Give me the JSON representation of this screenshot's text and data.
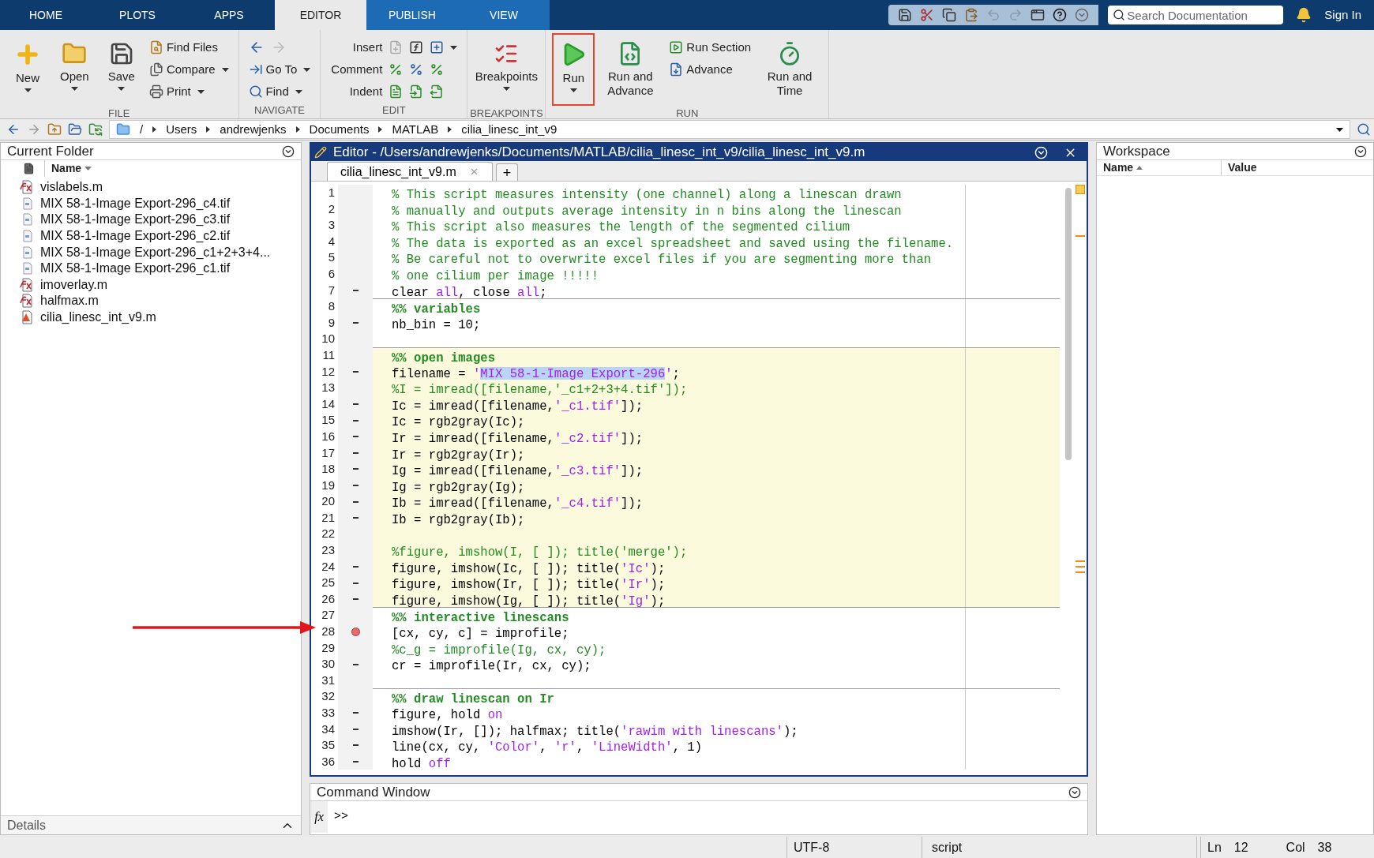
{
  "top_tabs": [
    {
      "label": "HOME",
      "selected": false,
      "contextual": false
    },
    {
      "label": "PLOTS",
      "selected": false,
      "contextual": false
    },
    {
      "label": "APPS",
      "selected": false,
      "contextual": false
    },
    {
      "label": "EDITOR",
      "selected": true
    },
    {
      "label": "PUBLISH",
      "selected": false,
      "contextual": true
    },
    {
      "label": "VIEW",
      "selected": false,
      "contextual": true
    }
  ],
  "search": {
    "placeholder": "Search Documentation"
  },
  "sign_in": "Sign In",
  "ribbon": [
    {
      "label": "FILE",
      "buttons": [
        {
          "kind": "large",
          "label": "New",
          "dropdown": true,
          "outlined": false
        },
        {
          "kind": "large",
          "label": "Open",
          "dropdown": true,
          "outlined": false
        },
        {
          "kind": "large",
          "label": "Save",
          "dropdown": true,
          "outlined": false
        },
        {
          "kind": "small",
          "label": "Find Files",
          "dropdown": false
        },
        {
          "kind": "small",
          "label": "Compare",
          "dropdown": true
        },
        {
          "kind": "small",
          "label": "Print",
          "dropdown": true
        }
      ]
    },
    {
      "label": "NAVIGATE",
      "buttons": [
        {
          "kind": "arrows"
        },
        {
          "kind": "small",
          "label": "Go To",
          "dropdown": true
        },
        {
          "kind": "small",
          "label": "Find",
          "dropdown": true
        }
      ]
    },
    {
      "label": "EDIT",
      "buttons": [
        {
          "kind": "edit_row",
          "label": "Insert"
        },
        {
          "kind": "edit_row",
          "label": "Comment"
        },
        {
          "kind": "edit_row",
          "label": "Indent"
        }
      ]
    },
    {
      "label": "BREAKPOINTS",
      "buttons": [
        {
          "kind": "large",
          "label": "Breakpoints",
          "dropdown": true,
          "outlined": false
        }
      ]
    },
    {
      "label": "RUN",
      "buttons": [
        {
          "kind": "large",
          "label": "Run",
          "dropdown": true,
          "outlined": true
        },
        {
          "kind": "large",
          "label": "Run and Advance",
          "dropdown": false,
          "outlined": false
        },
        {
          "kind": "small",
          "label": "Run Section",
          "dropdown": false
        },
        {
          "kind": "small",
          "label": "Advance",
          "dropdown": false
        },
        {
          "kind": "large",
          "label": "Run and Time",
          "dropdown": false,
          "outlined": false
        }
      ]
    }
  ],
  "path": [
    "/",
    "Users",
    "andrewjenks",
    "Documents",
    "MATLAB",
    "cilia_linesc_int_v9"
  ],
  "current_folder": {
    "title": "Current Folder",
    "column": "Name",
    "files": [
      {
        "kind": "function",
        "name": "vislabels.m"
      },
      {
        "kind": "image",
        "name": "MIX 58-1-Image Export-296_c4.tif"
      },
      {
        "kind": "image",
        "name": "MIX 58-1-Image Export-296_c3.tif"
      },
      {
        "kind": "image",
        "name": "MIX 58-1-Image Export-296_c2.tif"
      },
      {
        "kind": "image",
        "name": "MIX 58-1-Image Export-296_c1+2+3+4..."
      },
      {
        "kind": "image",
        "name": "MIX 58-1-Image Export-296_c1.tif"
      },
      {
        "kind": "function",
        "name": "imoverlay.m"
      },
      {
        "kind": "function",
        "name": "halfmax.m"
      },
      {
        "kind": "script",
        "name": "cilia_linesc_int_v9.m"
      }
    ],
    "details": "Details"
  },
  "editor": {
    "title": "Editor - /Users/andrewjenks/Documents/MATLAB/cilia_linesc_int_v9/cilia_linesc_int_v9.m",
    "tabs": [
      {
        "label": "cilia_linesc_int_v9.m",
        "selected": true
      }
    ],
    "add_tab": "+",
    "lines": [
      {
        "n": "1",
        "exec": false,
        "breakpoint": false,
        "highlighted": false,
        "tokens": [
          {
            "kind": "comment",
            "text": "% This script measures intensity (one channel) along a linescan drawn"
          }
        ]
      },
      {
        "n": "2",
        "exec": false,
        "breakpoint": false,
        "highlighted": false,
        "tokens": [
          {
            "kind": "comment",
            "text": "% manually and outputs average intensity in n bins along the linescan"
          }
        ]
      },
      {
        "n": "3",
        "exec": false,
        "breakpoint": false,
        "highlighted": false,
        "tokens": [
          {
            "kind": "comment",
            "text": "% This script also measures the length of the segmented cilium"
          }
        ]
      },
      {
        "n": "4",
        "exec": false,
        "breakpoint": false,
        "highlighted": false,
        "tokens": [
          {
            "kind": "comment",
            "text": "% The data is exported as an excel spreadsheet and saved using the filename."
          }
        ]
      },
      {
        "n": "5",
        "exec": false,
        "breakpoint": false,
        "highlighted": false,
        "tokens": [
          {
            "kind": "comment",
            "text": "% Be careful not to overwrite excel files if you are segmenting more than"
          }
        ]
      },
      {
        "n": "6",
        "exec": false,
        "breakpoint": false,
        "highlighted": false,
        "tokens": [
          {
            "kind": "comment",
            "text": "% one cilium per image !!!!!"
          }
        ]
      },
      {
        "n": "7",
        "exec": true,
        "breakpoint": false,
        "highlighted": false,
        "tokens": [
          {
            "kind": "code",
            "text": "clear "
          },
          {
            "kind": "keyword",
            "text": "all"
          },
          {
            "kind": "code",
            "text": ", close "
          },
          {
            "kind": "keyword",
            "text": "all"
          },
          {
            "kind": "code",
            "text": ";"
          }
        ]
      },
      {
        "n": "8",
        "exec": false,
        "breakpoint": false,
        "highlighted": false,
        "tokens": [
          {
            "kind": "section",
            "text": "%% variables"
          }
        ]
      },
      {
        "n": "9",
        "exec": true,
        "breakpoint": false,
        "highlighted": false,
        "tokens": [
          {
            "kind": "code",
            "text": "nb_bin = 10;"
          }
        ]
      },
      {
        "n": "10",
        "exec": false,
        "breakpoint": false,
        "highlighted": false
      },
      {
        "n": "11",
        "exec": false,
        "breakpoint": false,
        "highlighted": true,
        "tokens": [
          {
            "kind": "section",
            "text": "%% open images"
          }
        ]
      },
      {
        "n": "12",
        "exec": true,
        "breakpoint": false,
        "highlighted": true,
        "tokens": [
          {
            "kind": "code",
            "text": "filename = "
          },
          {
            "kind": "string",
            "text": "'"
          },
          {
            "kind": "selection",
            "text": "MIX 58-1-Image Export-296"
          },
          {
            "kind": "string",
            "text": "'"
          },
          {
            "kind": "code",
            "text": ";"
          }
        ]
      },
      {
        "n": "13",
        "exec": false,
        "breakpoint": false,
        "highlighted": true,
        "tokens": [
          {
            "kind": "comment",
            "text": "%I = imread([filename,'_c1+2+3+4.tif']);"
          }
        ]
      },
      {
        "n": "14",
        "exec": true,
        "breakpoint": false,
        "highlighted": true,
        "tokens": [
          {
            "kind": "code",
            "text": "Ic = imread([filename,"
          },
          {
            "kind": "string",
            "text": "'_c1.tif'"
          },
          {
            "kind": "code",
            "text": "]);"
          }
        ]
      },
      {
        "n": "15",
        "exec": true,
        "breakpoint": false,
        "highlighted": true,
        "tokens": [
          {
            "kind": "code",
            "text": "Ic = rgb2gray(Ic);"
          }
        ]
      },
      {
        "n": "16",
        "exec": true,
        "breakpoint": false,
        "highlighted": true,
        "tokens": [
          {
            "kind": "code",
            "text": "Ir = imread([filename,"
          },
          {
            "kind": "string",
            "text": "'_c2.tif'"
          },
          {
            "kind": "code",
            "text": "]);"
          }
        ]
      },
      {
        "n": "17",
        "exec": true,
        "breakpoint": false,
        "highlighted": true,
        "tokens": [
          {
            "kind": "code",
            "text": "Ir = rgb2gray(Ir);"
          }
        ]
      },
      {
        "n": "18",
        "exec": true,
        "breakpoint": false,
        "highlighted": true,
        "tokens": [
          {
            "kind": "code",
            "text": "Ig = imread([filename,"
          },
          {
            "kind": "string",
            "text": "'_c3.tif'"
          },
          {
            "kind": "code",
            "text": "]);"
          }
        ]
      },
      {
        "n": "19",
        "exec": true,
        "breakpoint": false,
        "highlighted": true,
        "tokens": [
          {
            "kind": "code",
            "text": "Ig = rgb2gray(Ig);"
          }
        ]
      },
      {
        "n": "20",
        "exec": true,
        "breakpoint": false,
        "highlighted": true,
        "tokens": [
          {
            "kind": "code",
            "text": "Ib = imread([filename,"
          },
          {
            "kind": "string",
            "text": "'_c4.tif'"
          },
          {
            "kind": "code",
            "text": "]);"
          }
        ]
      },
      {
        "n": "21",
        "exec": true,
        "breakpoint": false,
        "highlighted": true,
        "tokens": [
          {
            "kind": "code",
            "text": "Ib = rgb2gray(Ib);"
          }
        ]
      },
      {
        "n": "22",
        "exec": false,
        "breakpoint": false,
        "highlighted": true
      },
      {
        "n": "23",
        "exec": false,
        "breakpoint": false,
        "highlighted": true,
        "tokens": [
          {
            "kind": "comment",
            "text": "%figure, imshow(I, [ ]); title('merge');"
          }
        ]
      },
      {
        "n": "24",
        "exec": true,
        "breakpoint": false,
        "highlighted": true,
        "tokens": [
          {
            "kind": "code",
            "text": "figure, imshow(Ic, [ ]); title("
          },
          {
            "kind": "string",
            "text": "'Ic'"
          },
          {
            "kind": "code",
            "text": ");"
          }
        ]
      },
      {
        "n": "25",
        "exec": true,
        "breakpoint": false,
        "highlighted": true,
        "tokens": [
          {
            "kind": "code",
            "text": "figure, imshow(Ir, [ ]); title("
          },
          {
            "kind": "string",
            "text": "'Ir'"
          },
          {
            "kind": "code",
            "text": ");"
          }
        ]
      },
      {
        "n": "26",
        "exec": true,
        "breakpoint": false,
        "highlighted": true,
        "tokens": [
          {
            "kind": "code",
            "text": "figure, imshow(Ig, [ ]); title("
          },
          {
            "kind": "string",
            "text": "'Ig'"
          },
          {
            "kind": "code",
            "text": ");"
          }
        ]
      },
      {
        "n": "27",
        "exec": false,
        "breakpoint": false,
        "highlighted": false,
        "tokens": [
          {
            "kind": "section",
            "text": "%% interactive linescans"
          }
        ]
      },
      {
        "n": "28",
        "breakpoint": true,
        "highlighted": false,
        "tokens": [
          {
            "kind": "code",
            "text": "[cx, cy, c] = improfile;"
          }
        ]
      },
      {
        "n": "29",
        "exec": false,
        "breakpoint": false,
        "highlighted": false,
        "tokens": [
          {
            "kind": "comment",
            "text": "%c_g = improfile(Ig, cx, cy);"
          }
        ]
      },
      {
        "n": "30",
        "exec": true,
        "breakpoint": false,
        "highlighted": false,
        "tokens": [
          {
            "kind": "code",
            "text": "cr = improfile(Ir, cx, cy);"
          }
        ]
      },
      {
        "n": "31",
        "exec": false,
        "breakpoint": false,
        "highlighted": false
      },
      {
        "n": "32",
        "exec": false,
        "breakpoint": false,
        "highlighted": false,
        "tokens": [
          {
            "kind": "section",
            "text": "%% draw linescan on Ir"
          }
        ]
      },
      {
        "n": "33",
        "exec": true,
        "breakpoint": false,
        "highlighted": false,
        "tokens": [
          {
            "kind": "code",
            "text": "figure, hold "
          },
          {
            "kind": "keyword",
            "text": "on"
          }
        ]
      },
      {
        "n": "34",
        "exec": true,
        "breakpoint": false,
        "highlighted": false,
        "tokens": [
          {
            "kind": "code",
            "text": "imshow(Ir, []); halfmax; title("
          },
          {
            "kind": "string",
            "text": "'rawim with linescans'"
          },
          {
            "kind": "code",
            "text": ");"
          }
        ]
      },
      {
        "n": "35",
        "exec": true,
        "breakpoint": false,
        "highlighted": false,
        "tokens": [
          {
            "kind": "code",
            "text": "line(cx, cy, "
          },
          {
            "kind": "string",
            "text": "'Color'"
          },
          {
            "kind": "code",
            "text": ", "
          },
          {
            "kind": "string",
            "text": "'r'"
          },
          {
            "kind": "code",
            "text": ", "
          },
          {
            "kind": "string",
            "text": "'LineWidth'"
          },
          {
            "kind": "code",
            "text": ", 1)"
          }
        ]
      },
      {
        "n": "36",
        "exec": true,
        "breakpoint": false,
        "highlighted": false,
        "tokens": [
          {
            "kind": "code",
            "text": "hold "
          },
          {
            "kind": "keyword",
            "text": "off"
          }
        ]
      }
    ]
  },
  "workspace": {
    "title": "Workspace",
    "columns": [
      "Name",
      "Value"
    ]
  },
  "command_window": {
    "title": "Command Window",
    "fx": "fx",
    "prompt": ">>"
  },
  "status_bar": {
    "encoding": "UTF-8",
    "type": "script",
    "ln_label": "Ln",
    "ln": "12",
    "col_label": "Col",
    "col": "38"
  }
}
